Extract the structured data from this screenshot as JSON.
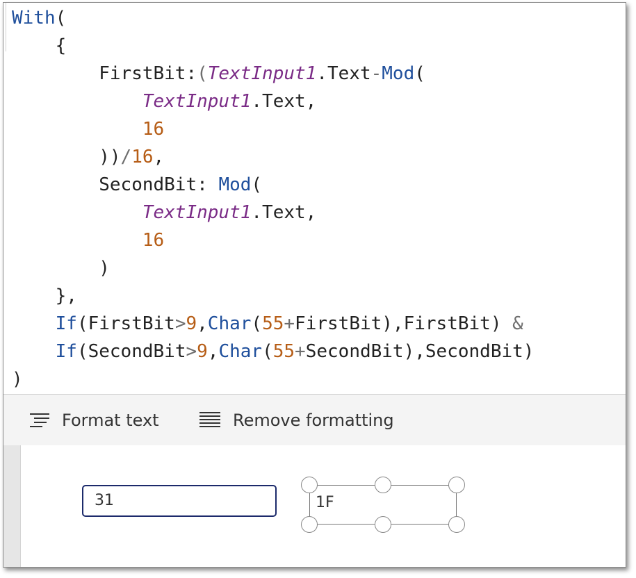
{
  "code": {
    "with": "With",
    "open_paren": "(",
    "close_paren": ")",
    "open_brace": "{",
    "close_brace": "},",
    "first_bit": "FirstBit",
    "second_bit": "SecondBit",
    "text_input": "TextInput1",
    "text_prop": ".Text",
    "mod": "Mod",
    "if": "If",
    "char": "Char",
    "sixteen": "16",
    "nine": "9",
    "fifty_five": "55",
    "concat": "&"
  },
  "toolbar": {
    "format_text_label": "Format text",
    "remove_formatting_label": "Remove formatting"
  },
  "canvas": {
    "input_value": "31",
    "label_value": "1F"
  }
}
